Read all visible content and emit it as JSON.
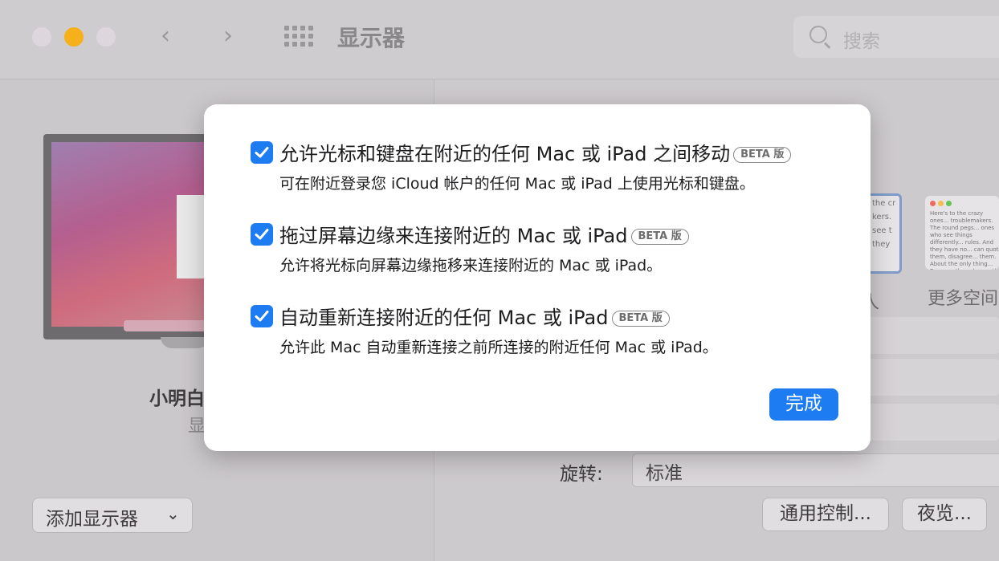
{
  "window": {
    "title": "显示器",
    "search_placeholder": "搜索",
    "nav_back": "‹",
    "nav_forward": "›"
  },
  "left": {
    "display_name": "小明白",
    "display_sub": "显",
    "add_display": "添加显示器",
    "add_display_chevron": "⌄"
  },
  "right": {
    "thumb1_lines": [
      "the cr",
      "kers.",
      "see t",
      "they"
    ],
    "thumb2_text": "Here's to the crazy ones... troublemakers. The round pegs... ones who see things differently... rules. And they have no... can quote them, disagree... them. About the only thing... Because they change th",
    "partial_label": "人",
    "more_space": "更多空间",
    "rotate_label": "旋转:",
    "rotate_value": "标准",
    "universal_control_button": "通用控制...",
    "night_shift_button": "夜览..."
  },
  "dialog": {
    "options": [
      {
        "checked": true,
        "title": "允许光标和键盘在附近的任何 Mac 或 iPad 之间移动",
        "badge": "BETA 版",
        "description": "可在附近登录您 iCloud 帐户的任何 Mac 或 iPad 上使用光标和键盘。"
      },
      {
        "checked": true,
        "title": "拖过屏幕边缘来连接附近的 Mac 或 iPad",
        "badge": "BETA 版",
        "description": "允许将光标向屏幕边缘拖移来连接附近的 Mac 或 iPad。"
      },
      {
        "checked": true,
        "title": "自动重新连接附近的任何 Mac 或 iPad",
        "badge": "BETA 版",
        "description": "允许此 Mac 自动重新连接之前所连接的附近任何 Mac 或 iPad。"
      }
    ],
    "done_button": "完成"
  },
  "colors": {
    "accent": "#1e7cf2",
    "traffic_minimize": "#f5b01c"
  }
}
